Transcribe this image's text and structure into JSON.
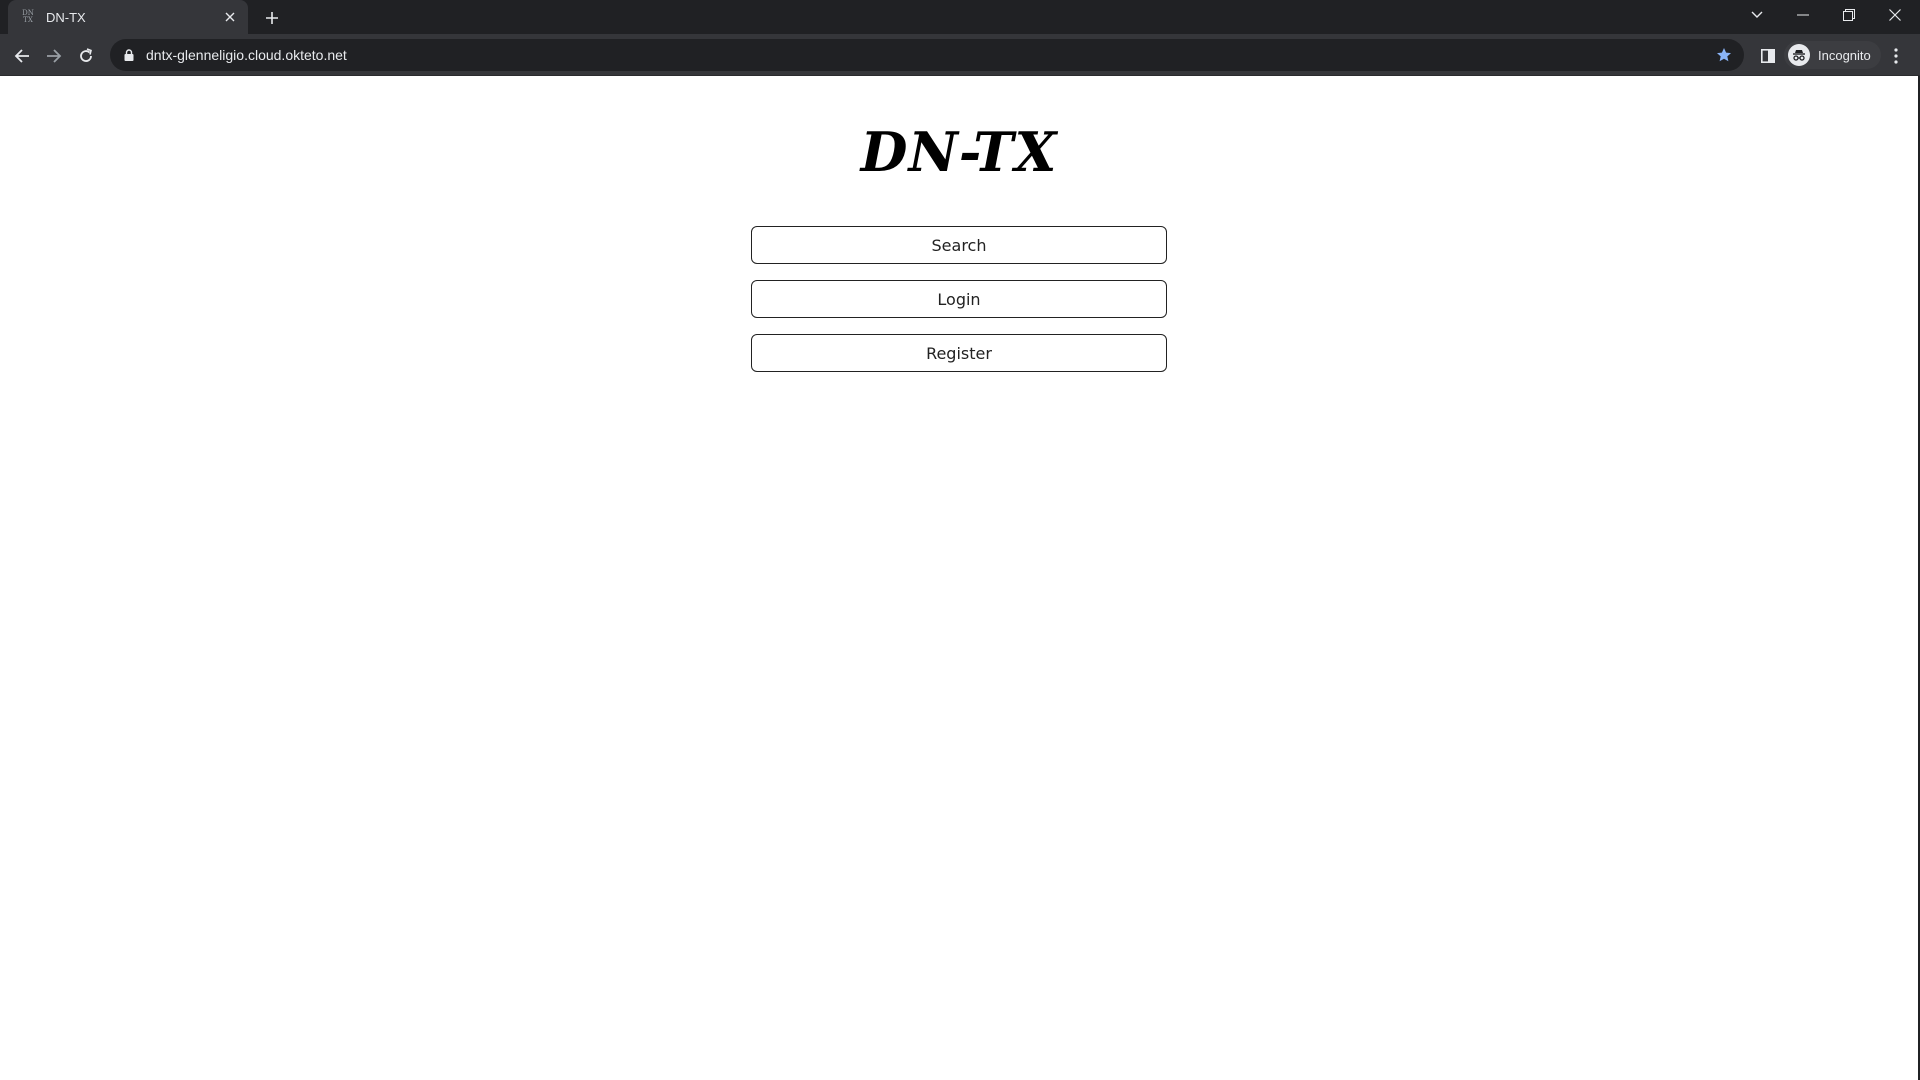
{
  "browser": {
    "tab_title": "DN-TX",
    "favicon_text": [
      "DN",
      "TX"
    ],
    "url": "dntx-glenneligio.cloud.okteto.net",
    "profile_label": "Incognito",
    "icons": {
      "tab_close": "close-icon",
      "new_tab": "plus-icon",
      "tab_search": "chevron-down-icon",
      "minimize": "minimize-icon",
      "restore": "restore-icon",
      "close_window": "close-icon",
      "back": "back-arrow-icon",
      "forward": "forward-arrow-icon",
      "reload": "reload-icon",
      "lock": "lock-icon",
      "bookmark": "star-icon",
      "side_panel": "side-panel-icon",
      "incognito": "incognito-icon",
      "menu": "kebab-menu-icon"
    },
    "colors": {
      "frame": "#202124",
      "toolbar": "#35363a",
      "star": "#8ab4f8"
    }
  },
  "page": {
    "title": "DN-TX",
    "buttons": {
      "search": "Search",
      "login": "Login",
      "register": "Register"
    }
  }
}
